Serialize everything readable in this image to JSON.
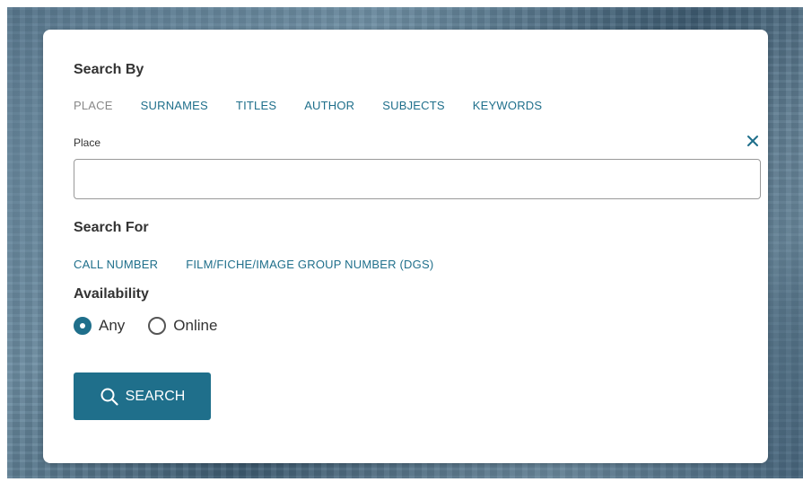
{
  "search_by": {
    "heading": "Search By",
    "tabs": [
      {
        "label": "PLACE",
        "active": true
      },
      {
        "label": "SURNAMES",
        "active": false
      },
      {
        "label": "TITLES",
        "active": false
      },
      {
        "label": "AUTHOR",
        "active": false
      },
      {
        "label": "SUBJECTS",
        "active": false
      },
      {
        "label": "KEYWORDS",
        "active": false
      }
    ]
  },
  "place_field": {
    "label": "Place",
    "value": "",
    "placeholder": "",
    "clear_icon": "close-icon"
  },
  "search_for": {
    "heading": "Search For",
    "options": [
      {
        "label": "CALL NUMBER"
      },
      {
        "label": "FILM/FICHE/IMAGE GROUP NUMBER (DGS)"
      }
    ]
  },
  "availability": {
    "heading": "Availability",
    "options": [
      {
        "label": "Any",
        "checked": true
      },
      {
        "label": "Online",
        "checked": false
      }
    ]
  },
  "search_button": {
    "label": "SEARCH",
    "icon": "search-icon"
  },
  "colors": {
    "accent": "#1f6f8b",
    "inactive_tab": "#888888",
    "text": "#333333"
  }
}
